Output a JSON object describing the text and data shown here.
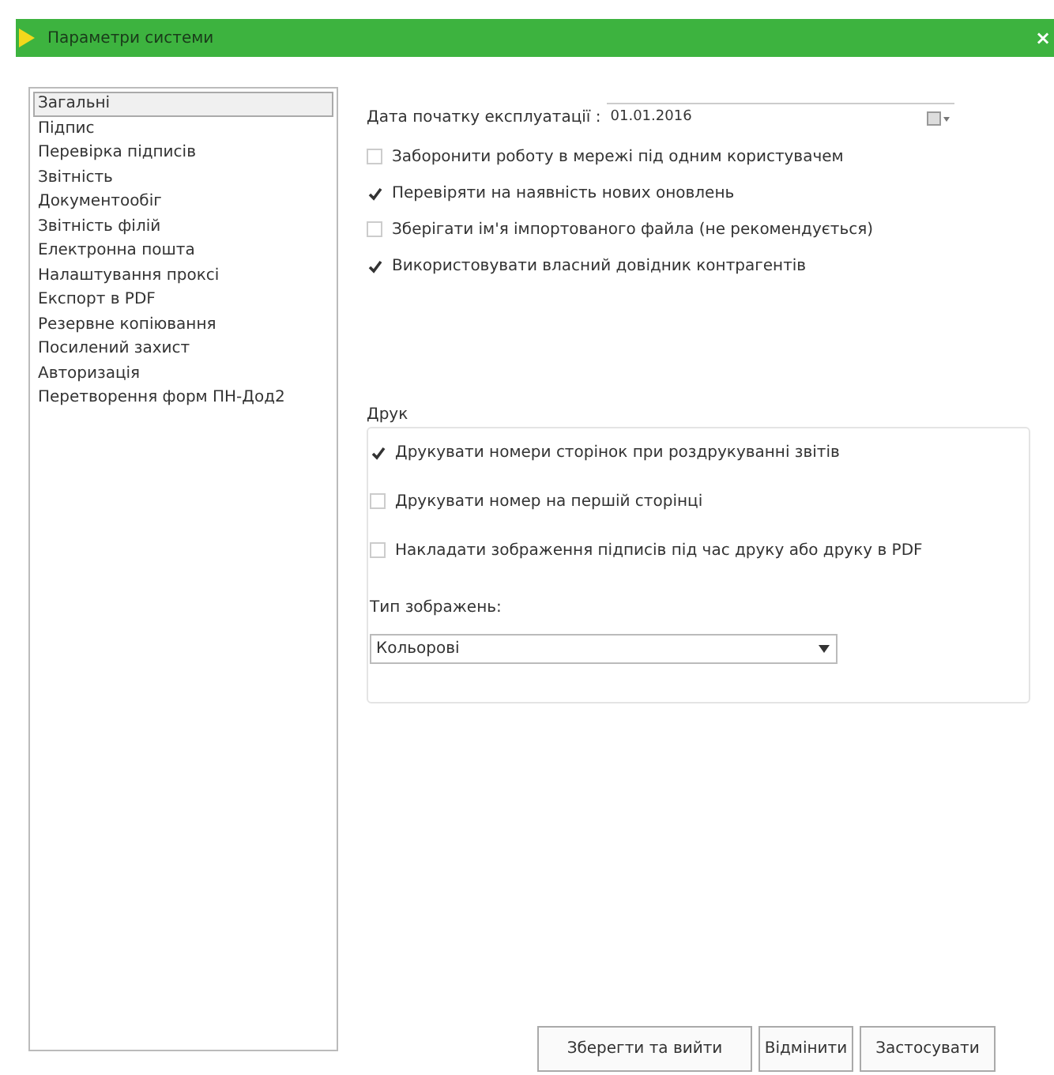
{
  "window": {
    "title": "Параметри системи",
    "close": "×"
  },
  "sidebar": {
    "items": [
      {
        "label": "Загальні",
        "selected": true
      },
      {
        "label": "Підпис",
        "selected": false
      },
      {
        "label": "Перевірка підписів",
        "selected": false
      },
      {
        "label": "Звітність",
        "selected": false
      },
      {
        "label": "Документообіг",
        "selected": false
      },
      {
        "label": "Звітність філій",
        "selected": false
      },
      {
        "label": "Електронна пошта",
        "selected": false
      },
      {
        "label": "Налаштування проксі",
        "selected": false
      },
      {
        "label": "Експорт в PDF",
        "selected": false
      },
      {
        "label": "Резервне копіювання",
        "selected": false
      },
      {
        "label": "Посилений захист",
        "selected": false
      },
      {
        "label": "Авторизація",
        "selected": false
      },
      {
        "label": "Перетворення форм ПН-Дод2",
        "selected": false
      }
    ]
  },
  "general": {
    "date_label": "Дата початку експлуатації :",
    "date_value": "01.01.2016",
    "options": [
      {
        "label": "Заборонити роботу в мережі під одним користувачем",
        "checked": false
      },
      {
        "label": "Перевіряти на наявність нових оновлень",
        "checked": true
      },
      {
        "label": "Зберігати ім'я імпортованого файла (не рекомендується)",
        "checked": false
      },
      {
        "label": "Використовувати власний довідник контрагентів",
        "checked": true
      }
    ]
  },
  "print": {
    "title": "Друк",
    "options": [
      {
        "label": "Друкувати номери сторінок при роздрукуванні звітів",
        "checked": true
      },
      {
        "label": "Друкувати номер на першій сторінці",
        "checked": false
      },
      {
        "label": "Накладати зображення підписів під час друку або друку в PDF",
        "checked": false
      }
    ],
    "image_type_label": "Тип зображень:",
    "image_type_value": "Кольорові"
  },
  "buttons": [
    "Зберегти та вийти",
    "Відмінити",
    "Застосувати"
  ]
}
